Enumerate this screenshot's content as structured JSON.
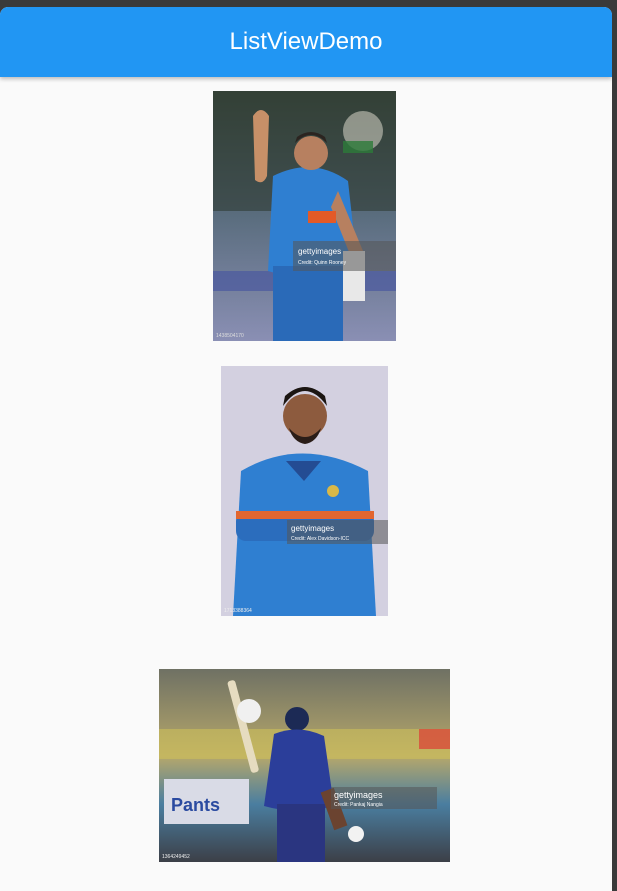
{
  "appbar": {
    "title": "ListViewDemo"
  },
  "list": {
    "items": [
      {
        "name": "player-photo-1",
        "watermark": "gettyimages",
        "credit": "Credit: Quinn Rooney",
        "id": "1438504170"
      },
      {
        "name": "player-photo-2",
        "watermark": "gettyimages",
        "credit": "Credit: Alex Davidson-ICC",
        "id": "1713388364"
      },
      {
        "name": "player-photo-3",
        "watermark": "gettyimages",
        "credit": "Credit: Pankaj Nangia",
        "id": "1364249452"
      }
    ]
  },
  "colors": {
    "appbar": "#2196f3",
    "background": "#fafafa",
    "jersey": "#2f7fd1"
  }
}
